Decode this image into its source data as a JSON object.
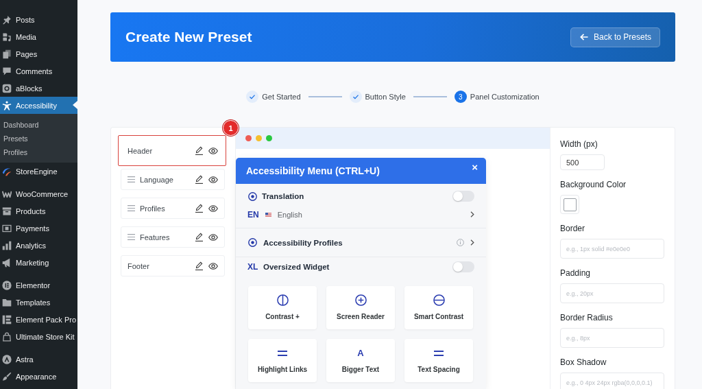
{
  "sidebar": {
    "groups": [
      {
        "items": [
          {
            "label": "Posts",
            "selected": false
          },
          {
            "label": "Media",
            "selected": false
          },
          {
            "label": "Pages",
            "selected": false
          },
          {
            "label": "Comments",
            "selected": false
          },
          {
            "label": "aBlocks",
            "selected": false
          },
          {
            "label": "Accessibility",
            "selected": true,
            "submenu": [
              {
                "label": "Dashboard",
                "selected": false
              },
              {
                "label": "Presets",
                "selected": false
              },
              {
                "label": "Profiles",
                "selected": false
              }
            ]
          },
          {
            "label": "StoreEngine",
            "selected": false
          }
        ]
      },
      {
        "items": [
          {
            "label": "WooCommerce",
            "selected": false
          },
          {
            "label": "Products",
            "selected": false
          },
          {
            "label": "Payments",
            "selected": false
          },
          {
            "label": "Analytics",
            "selected": false
          },
          {
            "label": "Marketing",
            "selected": false
          }
        ]
      },
      {
        "items": [
          {
            "label": "Elementor",
            "selected": false
          },
          {
            "label": "Templates",
            "selected": false
          },
          {
            "label": "Element Pack Pro",
            "selected": false
          },
          {
            "label": "Ultimate Store Kit",
            "selected": false
          }
        ]
      },
      {
        "items": [
          {
            "label": "Astra",
            "selected": false
          },
          {
            "label": "Appearance",
            "selected": false
          }
        ]
      }
    ]
  },
  "header": {
    "title": "Create New Preset",
    "back_button": "Back to Presets"
  },
  "steps": [
    {
      "label": "Get Started",
      "done": true
    },
    {
      "label": "Button Style",
      "done": true
    },
    {
      "label": "Panel Customization",
      "done": false,
      "number": "3"
    }
  ],
  "sections": [
    {
      "label": "Header",
      "draggable": false,
      "highlighted": true,
      "callout": "1"
    },
    {
      "label": "Language",
      "draggable": true,
      "highlighted": false
    },
    {
      "label": "Profiles",
      "draggable": true,
      "highlighted": false
    },
    {
      "label": "Features",
      "draggable": true,
      "highlighted": false
    },
    {
      "label": "Footer",
      "draggable": false,
      "highlighted": false
    }
  ],
  "preview": {
    "menu": {
      "title": "Accessibility Menu (CTRL+U)",
      "close": "×",
      "rows": [
        {
          "kind": "toggle",
          "label": "Translation",
          "on": false
        },
        {
          "kind": "language",
          "code": "EN",
          "label": "English"
        },
        {
          "kind": "link",
          "label": "Accessibility Profiles"
        },
        {
          "kind": "toggle",
          "prefix": "XL",
          "label": "Oversized Widget",
          "on": false
        }
      ],
      "features": [
        {
          "label": "Contrast +"
        },
        {
          "label": "Screen Reader"
        },
        {
          "label": "Smart Contrast"
        },
        {
          "label": "Highlight Links"
        },
        {
          "label": "Bigger Text",
          "icon_text": "A"
        },
        {
          "label": "Text Spacing"
        }
      ]
    }
  },
  "settings": {
    "fields": [
      {
        "kind": "number",
        "label": "Width (px)",
        "value": "500"
      },
      {
        "kind": "color",
        "label": "Background Color",
        "color": "#ffffff"
      },
      {
        "kind": "text",
        "label": "Border",
        "placeholder": "e.g., 1px solid #e0e0e0"
      },
      {
        "kind": "text",
        "label": "Padding",
        "placeholder": "e.g., 20px"
      },
      {
        "kind": "text",
        "label": "Border Radius",
        "placeholder": "e.g., 8px"
      },
      {
        "kind": "text",
        "label": "Box Shadow",
        "placeholder": "e.g., 0 4px 24px rgba(0,0,0,0.1)"
      }
    ]
  }
}
